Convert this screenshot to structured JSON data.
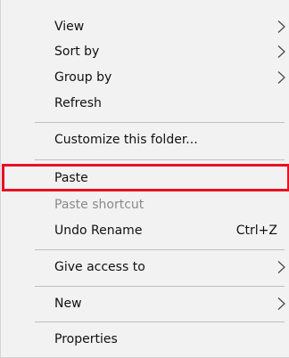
{
  "menu": {
    "items": [
      {
        "label": "View",
        "submenu": true
      },
      {
        "label": "Sort by",
        "submenu": true
      },
      {
        "label": "Group by",
        "submenu": true
      },
      {
        "label": "Refresh"
      },
      {
        "label": "Customize this folder..."
      },
      {
        "label": "Paste",
        "highlighted": true,
        "highlight_color": "#e81123"
      },
      {
        "label": "Paste shortcut",
        "disabled": true
      },
      {
        "label": "Undo Rename",
        "shortcut": "Ctrl+Z"
      },
      {
        "label": "Give access to",
        "submenu": true
      },
      {
        "label": "New",
        "submenu": true
      },
      {
        "label": "Properties"
      }
    ]
  },
  "colors": {
    "background": "#f2f2f2",
    "separator": "#bfbfbf",
    "disabled_text": "#8a8a8a",
    "highlight_border": "#e81123"
  },
  "icons": {
    "submenu_arrow": "chevron-right-icon"
  }
}
